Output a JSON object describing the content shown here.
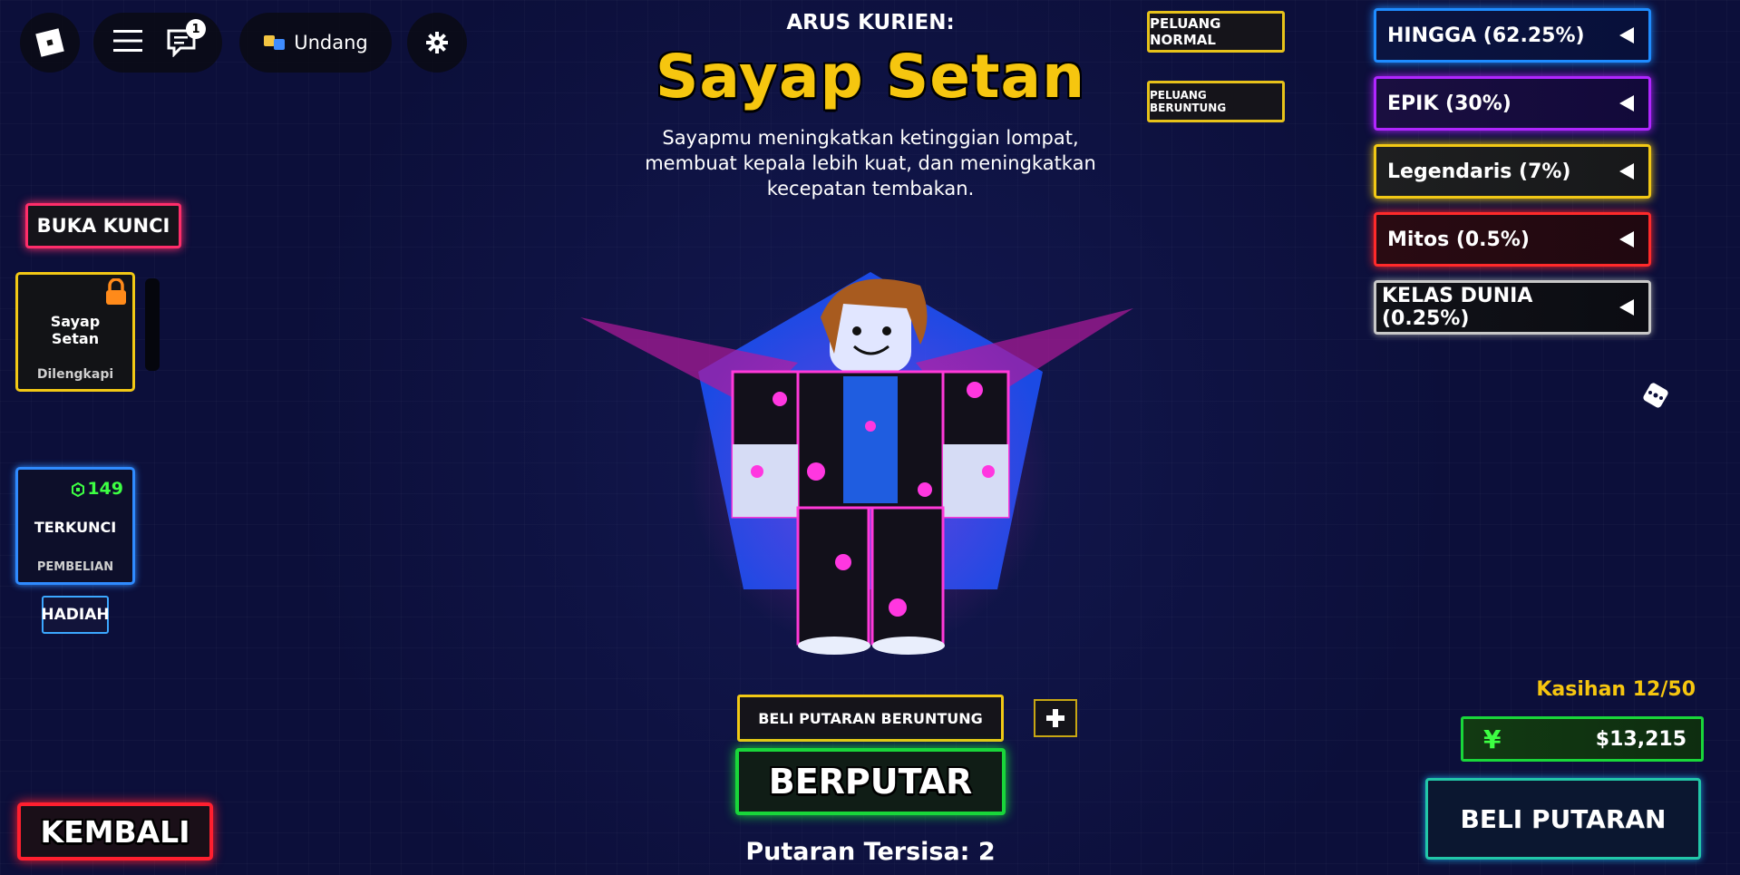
{
  "topbar": {
    "notification_count": "1",
    "invite_label": "Undang"
  },
  "header": {
    "current_label": "ARUS KURIEN:",
    "item_name": "Sayap Setan",
    "description": "Sayapmu meningkatkan ketinggian lompat, membuat kepala lebih kuat, dan meningkatkan kecepatan tembakan."
  },
  "chance_buttons": {
    "normal": "PELUANG NORMAL",
    "lucky": "PELUANG BERUNTUNG"
  },
  "rarities": [
    {
      "label": "HINGGA (62.25%)",
      "color": "#1e8cff"
    },
    {
      "label": "EPIK (30%)",
      "color": "#b026ff"
    },
    {
      "label": "Legendaris (7%)",
      "color": "#f2c815"
    },
    {
      "label": "Mitos (0.5%)",
      "color": "#ff2a2a"
    },
    {
      "label": "KELAS DUNIA (0.25%)",
      "color": "#c8c8c8"
    }
  ],
  "left_panel": {
    "unlock_label": "BUKA KUNCI",
    "slot1": {
      "name": "Sayap Setan",
      "status": "Dilengkapi"
    },
    "slot2": {
      "price": "149",
      "title": "TERKUNCI",
      "subtitle": "PEMBELIAN"
    },
    "gift_label": "HADIAH",
    "back_label": "KEMBALI"
  },
  "bottom": {
    "buy_lucky_label": "BELI PUTARAN BERUNTUNG",
    "spin_label": "BERPUTAR",
    "spins_left": "Putaran Tersisa: 2",
    "pity": "Kasihan 12/50",
    "currency_symbol": "¥",
    "money": "$13,215",
    "buy_spin_label": "BELI PUTARAN"
  },
  "colors": {
    "accent_gold": "#f6c60f",
    "spin_green": "#19d63a",
    "back_red": "#ff1f2f"
  }
}
